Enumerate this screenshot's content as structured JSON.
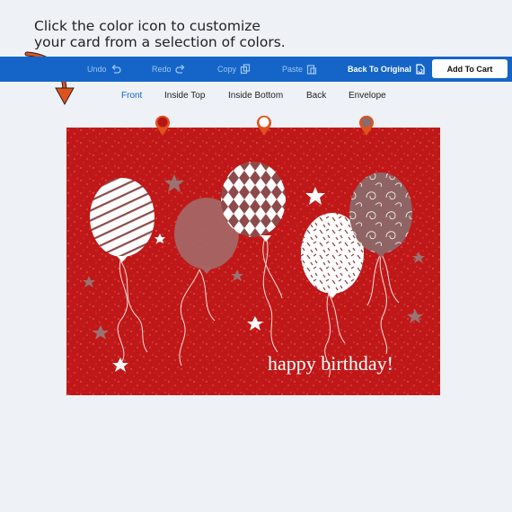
{
  "instruction": {
    "line1": "Click the color icon to customize",
    "line2": "your card from a selection of colors."
  },
  "toolbar": {
    "undo": "Undo",
    "redo": "Redo",
    "copy": "Copy",
    "paste": "Paste",
    "back_to_original": "Back To Original",
    "add_to_cart": "Add To Cart"
  },
  "tabs": [
    "Front",
    "Inside Top",
    "Inside Bottom",
    "Back",
    "Envelope"
  ],
  "active_tab": "Front",
  "card": {
    "greeting": "happy birthday!"
  },
  "color_pins": [
    {
      "color": "#b81414"
    },
    {
      "color": "#ffffff"
    },
    {
      "color": "#8a6a6a"
    }
  ],
  "colors": {
    "toolbar_bg": "#1565c8",
    "card_bg": "#c01818",
    "arrow": "#e0521d",
    "pin_border": "#e0521d"
  }
}
